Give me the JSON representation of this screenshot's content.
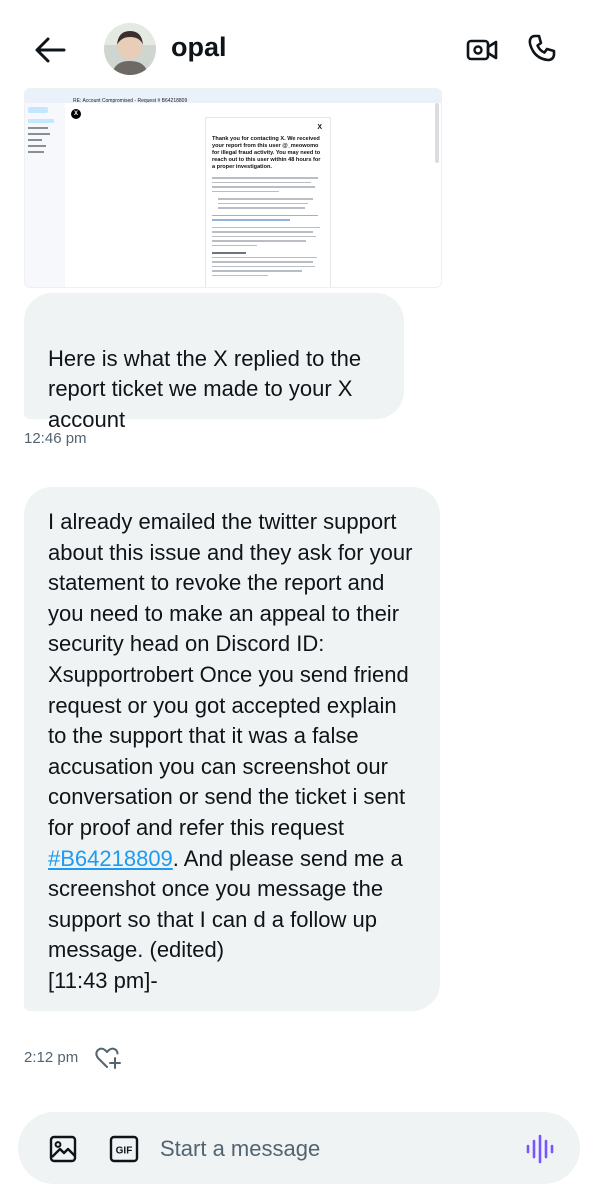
{
  "header": {
    "contact_name": "opal"
  },
  "attachment": {
    "email_subject": "RE: Account Compromised - Request # B64218809",
    "card_title": "Thank you for contacting X. We received your report from this user @_meowomo for illegal fraud activity. You may need to reach out to this user within 48 hours for a proper investigation."
  },
  "messages": [
    {
      "text": "Here is what the X replied to the report ticket we made to your X account",
      "time": "12:46 pm"
    },
    {
      "text_before_link": "I already emailed the twitter support about this issue and they ask for your statement to revoke the report and you need to make an appeal to their security head on Discord ID: Xsupportrobert Once you send friend request or you got accepted explain to the support that it was a false accusation you can screenshot our conversation or send the ticket i sent for proof and refer this request ",
      "link_text": "#B64218809",
      "text_after_link": ". And please send me a screenshot once you message the support so that I can d a follow up message. (edited)\n[11:43 pm]-",
      "time": "2:12 pm"
    }
  ],
  "composer": {
    "placeholder": "Start a message"
  },
  "colors": {
    "bubble_bg": "#eff3f4",
    "link": "#1d9bf0",
    "voice_accent": "#7856ff",
    "muted_text": "#536471"
  },
  "icons": [
    "back-arrow-icon",
    "video-call-icon",
    "phone-icon",
    "image-icon",
    "gif-icon",
    "voice-icon",
    "add-reaction-icon"
  ]
}
